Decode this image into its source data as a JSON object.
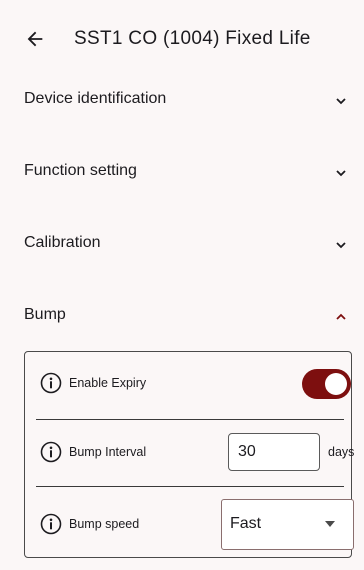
{
  "app_bar": {
    "title": "SST1 CO (1004) Fixed Life",
    "back_icon": "arrow-left-icon"
  },
  "sections": [
    {
      "label": "Device identification",
      "expanded": false
    },
    {
      "label": "Function setting",
      "expanded": false
    },
    {
      "label": "Calibration",
      "expanded": false
    },
    {
      "label": "Bump",
      "expanded": true
    }
  ],
  "bump": {
    "enable_expiry": {
      "label": "Enable Expiry",
      "on": true
    },
    "bump_interval": {
      "label": "Bump Interval",
      "value": "30",
      "units": "days"
    },
    "bump_speed": {
      "label": "Bump speed",
      "selected": "Fast"
    }
  },
  "colors": {
    "accent": "#7d0f0f",
    "background": "#fbf7f7",
    "text": "#1c1b1f"
  }
}
